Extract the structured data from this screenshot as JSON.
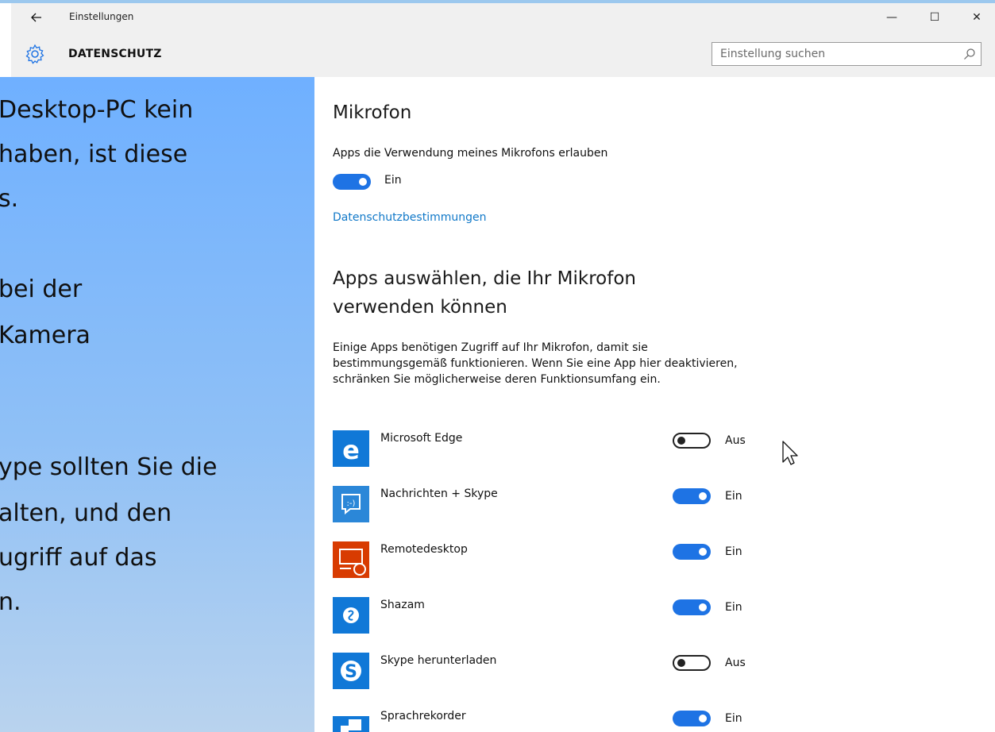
{
  "window": {
    "title": "Einstellungen",
    "controls": {
      "minimize": "—",
      "maximize": "☐",
      "close": "✕"
    }
  },
  "header": {
    "heading": "DATENSCHUTZ",
    "search_placeholder": "Einstellung suchen"
  },
  "slide_text": {
    "lines": [
      "Desktop-PC kein",
      "haben, ist diese",
      "s.",
      "",
      "bei der",
      " Kamera",
      "",
      "",
      "ype sollten Sie die",
      "alten, und den",
      "ugriff auf das",
      "n."
    ]
  },
  "mikrofon": {
    "title": "Mikrofon",
    "allow_label": "Apps die Verwendung meines Mikrofons erlauben",
    "allow_state": "Ein",
    "privacy_link": "Datenschutzbestimmungen"
  },
  "apps_section": {
    "title": "Apps auswählen, die Ihr Mikrofon verwenden können",
    "description": "Einige Apps benötigen Zugriff auf Ihr Mikrofon, damit sie bestimmungsgemäß funktionieren. Wenn Sie eine App hier deaktivieren, schränken Sie möglicherweise deren Funktionsumfang ein.",
    "apps": [
      {
        "name": "Microsoft Edge",
        "state": "Aus",
        "on": false,
        "icon": "edge-icon",
        "color": "#1078d7"
      },
      {
        "name": "Nachrichten + Skype",
        "state": "Ein",
        "on": true,
        "icon": "messaging-icon",
        "color": "#2b87d8"
      },
      {
        "name": "Remotedesktop",
        "state": "Ein",
        "on": true,
        "icon": "remote-desktop-icon",
        "color": "#d83b01"
      },
      {
        "name": "Shazam",
        "state": "Ein",
        "on": true,
        "icon": "shazam-icon",
        "color": "#1078d7"
      },
      {
        "name": "Skype herunterladen",
        "state": "Aus",
        "on": false,
        "icon": "skype-icon",
        "color": "#1078d7"
      },
      {
        "name": "Sprachrekorder",
        "state": "Ein",
        "on": true,
        "icon": "voice-recorder-icon",
        "color": "#1078d7"
      }
    ]
  },
  "colors": {
    "accent": "#1e73e4",
    "link": "#1078c8"
  }
}
